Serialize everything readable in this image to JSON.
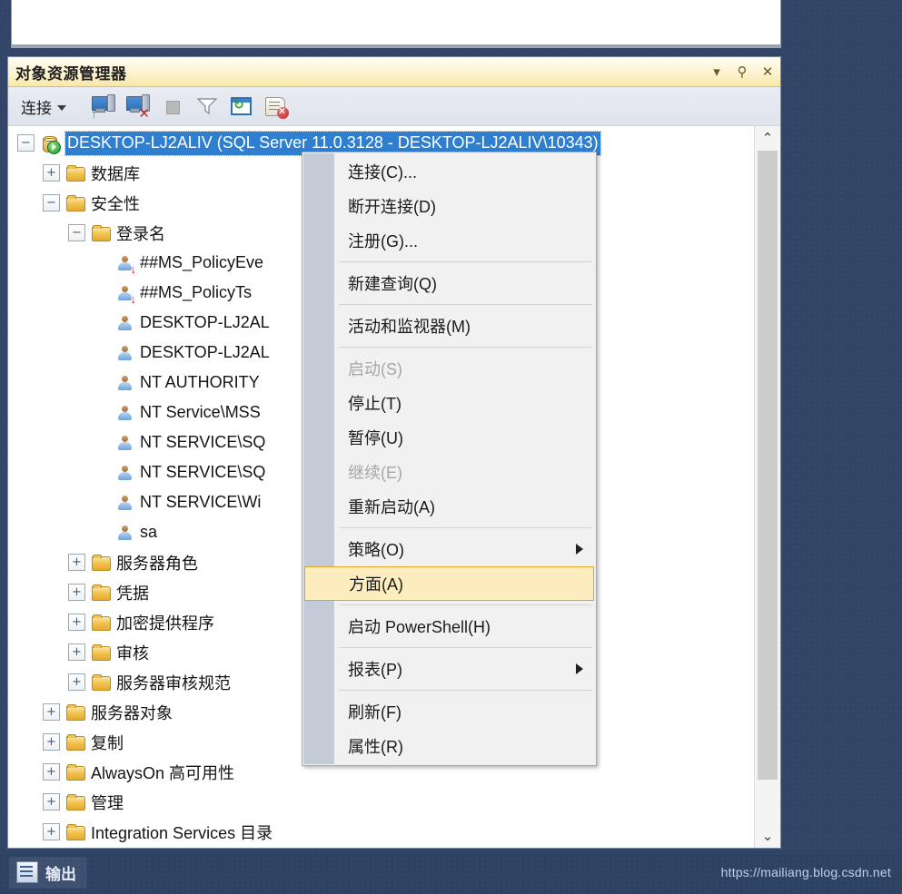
{
  "panel": {
    "title": "对象资源管理器",
    "title_buttons": [
      {
        "name": "dropdown",
        "glyph": "▾"
      },
      {
        "name": "pin",
        "glyph": "⚲"
      },
      {
        "name": "close",
        "glyph": "✕"
      }
    ],
    "toolbar": {
      "connect_label": "连接",
      "icons": [
        {
          "name": "connect-icon",
          "title": "连接"
        },
        {
          "name": "disconnect-icon",
          "title": "断开连接"
        },
        {
          "name": "stop-icon",
          "title": "停止",
          "disabled": true
        },
        {
          "name": "filter-icon",
          "title": "筛选"
        },
        {
          "name": "refresh-icon",
          "title": "刷新"
        },
        {
          "name": "cancel-script-icon",
          "title": "停止执行"
        }
      ]
    }
  },
  "tree": {
    "nodes": [
      {
        "label": "DESKTOP-LJ2ALIV (SQL Server 11.0.3128 - DESKTOP-LJ2ALIV\\10343)",
        "level": 0,
        "expander": "−",
        "icon": "server-db-icon",
        "selected": true
      },
      {
        "label": "数据库",
        "level": 1,
        "expander": "+",
        "icon": "folder-icon"
      },
      {
        "label": "安全性",
        "level": 1,
        "expander": "−",
        "icon": "folder-icon"
      },
      {
        "label": "登录名",
        "level": 2,
        "expander": "−",
        "icon": "folder-icon"
      },
      {
        "label": "##MS_PolicyEve",
        "level": 3,
        "expander": "",
        "icon": "login-disabled-icon"
      },
      {
        "label": "##MS_PolicyTs",
        "level": 3,
        "expander": "",
        "icon": "login-disabled-icon"
      },
      {
        "label": "DESKTOP-LJ2AL",
        "level": 3,
        "expander": "",
        "icon": "login-icon"
      },
      {
        "label": "DESKTOP-LJ2AL",
        "level": 3,
        "expander": "",
        "icon": "login-icon"
      },
      {
        "label": "NT AUTHORITY",
        "level": 3,
        "expander": "",
        "icon": "login-icon"
      },
      {
        "label": "NT Service\\MSS",
        "level": 3,
        "expander": "",
        "icon": "login-icon"
      },
      {
        "label": "NT SERVICE\\SQ",
        "level": 3,
        "expander": "",
        "icon": "login-icon"
      },
      {
        "label": "NT SERVICE\\SQ",
        "level": 3,
        "expander": "",
        "icon": "login-icon"
      },
      {
        "label": "NT SERVICE\\Wi",
        "level": 3,
        "expander": "",
        "icon": "login-icon"
      },
      {
        "label": "sa",
        "level": 3,
        "expander": "",
        "icon": "login-icon"
      },
      {
        "label": "服务器角色",
        "level": 2,
        "expander": "+",
        "icon": "folder-icon"
      },
      {
        "label": "凭据",
        "level": 2,
        "expander": "+",
        "icon": "folder-icon"
      },
      {
        "label": "加密提供程序",
        "level": 2,
        "expander": "+",
        "icon": "folder-icon"
      },
      {
        "label": "审核",
        "level": 2,
        "expander": "+",
        "icon": "folder-icon"
      },
      {
        "label": "服务器审核规范",
        "level": 2,
        "expander": "+",
        "icon": "folder-icon"
      },
      {
        "label": "服务器对象",
        "level": 1,
        "expander": "+",
        "icon": "folder-icon"
      },
      {
        "label": "复制",
        "level": 1,
        "expander": "+",
        "icon": "folder-icon"
      },
      {
        "label": "AlwaysOn 高可用性",
        "level": 1,
        "expander": "+",
        "icon": "folder-icon"
      },
      {
        "label": "管理",
        "level": 1,
        "expander": "+",
        "icon": "folder-icon"
      },
      {
        "label": "Integration Services 目录",
        "level": 1,
        "expander": "+",
        "icon": "folder-icon"
      }
    ],
    "scrollbar": {
      "up_glyph": "⌃",
      "down_glyph": "⌄"
    }
  },
  "context_menu": {
    "items": [
      {
        "type": "item",
        "label": "连接(C)...",
        "state": "normal"
      },
      {
        "type": "item",
        "label": "断开连接(D)",
        "state": "normal"
      },
      {
        "type": "item",
        "label": "注册(G)...",
        "state": "normal"
      },
      {
        "type": "separator"
      },
      {
        "type": "item",
        "label": "新建查询(Q)",
        "state": "normal"
      },
      {
        "type": "separator"
      },
      {
        "type": "item",
        "label": "活动和监视器(M)",
        "state": "normal"
      },
      {
        "type": "separator"
      },
      {
        "type": "item",
        "label": "启动(S)",
        "state": "disabled"
      },
      {
        "type": "item",
        "label": "停止(T)",
        "state": "normal"
      },
      {
        "type": "item",
        "label": "暂停(U)",
        "state": "normal"
      },
      {
        "type": "item",
        "label": "继续(E)",
        "state": "disabled"
      },
      {
        "type": "item",
        "label": "重新启动(A)",
        "state": "normal"
      },
      {
        "type": "separator"
      },
      {
        "type": "item",
        "label": "策略(O)",
        "state": "normal",
        "submenu": true
      },
      {
        "type": "item",
        "label": "方面(A)",
        "state": "highlight"
      },
      {
        "type": "separator"
      },
      {
        "type": "item",
        "label": "启动 PowerShell(H)",
        "state": "normal"
      },
      {
        "type": "separator"
      },
      {
        "type": "item",
        "label": "报表(P)",
        "state": "normal",
        "submenu": true
      },
      {
        "type": "separator"
      },
      {
        "type": "item",
        "label": "刷新(F)",
        "state": "normal"
      },
      {
        "type": "item",
        "label": "属性(R)",
        "state": "normal"
      }
    ]
  },
  "status_bar": {
    "output_tab_label": "输出",
    "watermark": "https://mailiang.blog.csdn.net"
  },
  "colors": {
    "desktop": "#334566",
    "selection_blue": "#2f7fd1",
    "highlight_fill": "#fdedbe",
    "highlight_border": "#e2a32b",
    "title_bar": "#fdf3cf"
  }
}
